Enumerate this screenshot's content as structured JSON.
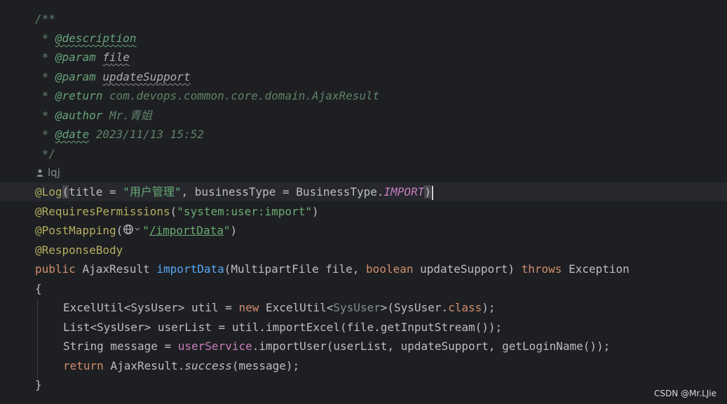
{
  "javadoc": {
    "open": "/**",
    "description_tag": "@description",
    "param_tag": "@param",
    "param1": "file",
    "param2": "updateSupport",
    "return_tag": "@return",
    "return_value": "com.devops.common.core.domain.AjaxResult",
    "author_tag": "@author",
    "author_value": "Mr.青姐",
    "date_tag": "@date",
    "date_value": "2023/11/13 15:52",
    "close": "*/"
  },
  "author_hint": {
    "icon": "person-icon",
    "name": "lqj"
  },
  "code": {
    "log_annotation": "@Log",
    "log_title_key": "title",
    "log_title_value": "\"用户管理\"",
    "log_btype_key": "businessType",
    "log_btype_class": "BusinessType.",
    "log_btype_const": "IMPORT",
    "requires_annotation": "@RequiresPermissions",
    "requires_value": "\"system:user:import\"",
    "postmapping_annotation": "@PostMapping",
    "postmapping_icon": "globe-icon",
    "postmapping_value": "/importData",
    "responsebody_annotation": "@ResponseBody",
    "kw_public": "public",
    "return_type": "AjaxResult",
    "method_name": "importData",
    "param1_type": "MultipartFile",
    "param1_name": "file",
    "kw_boolean": "boolean",
    "param2_name": "updateSupport",
    "kw_throws": "throws",
    "exception": "Exception",
    "open_brace": "{",
    "line1_type": "ExcelUtil<SysUser> util = ",
    "kw_new": "new",
    "line1_ctor": "ExcelUtil<",
    "line1_generic": "SysUser",
    "line1_rest_a": ">(SysUser.",
    "kw_class": "class",
    "line1_rest_b": ");",
    "line2": "List<SysUser> userList = util.importExcel(file.getInputStream());",
    "line3_a": "String message = ",
    "line3_field": "userService",
    "line3_b": ".importUser(userList, updateSupport, getLoginName());",
    "kw_return": "return",
    "line4_class": "AjaxResult.",
    "line4_method": "success",
    "line4_rest": "(message);",
    "close_brace": "}"
  },
  "watermark": "CSDN @Mr.LJie"
}
